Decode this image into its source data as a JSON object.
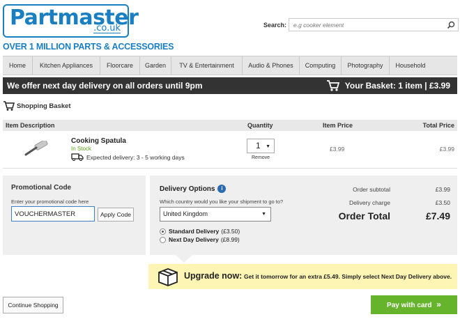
{
  "header": {
    "logo_main": "Partmaster",
    "logo_sub": ".co.uk",
    "tagline": "OVER 1 MILLION PARTS & ACCESSORIES",
    "search_label": "Search:",
    "search_placeholder": "e.g cooker element"
  },
  "nav": {
    "items": [
      {
        "label": "Home"
      },
      {
        "label": "Kitchen Appliances"
      },
      {
        "label": "Floorcare"
      },
      {
        "label": "Garden"
      },
      {
        "label": "TV & Entertainment"
      },
      {
        "label": "Audio & Phones"
      },
      {
        "label": "Computing"
      },
      {
        "label": "Photography"
      },
      {
        "label": "Household"
      }
    ]
  },
  "bar": {
    "message": "We offer next day delivery on all orders until 9pm",
    "basket": "Your Basket: 1 item | £3.99"
  },
  "basket": {
    "title": "Shopping Basket",
    "columns": {
      "description": "Item Description",
      "quantity": "Quantity",
      "item_price": "Item Price",
      "total_price": "Total Price"
    },
    "items": [
      {
        "name": "Cooking Spatula",
        "stock": "In Stock",
        "delivery": "Expected delivery: 3 - 5 working days",
        "quantity": "1",
        "remove": "Remove",
        "price": "£3.99",
        "total": "£3.99"
      }
    ]
  },
  "promo": {
    "title": "Promotional Code",
    "hint": "Enter your promotional code here",
    "value": "VOUCHERMASTER",
    "apply_label": "Apply Code"
  },
  "delivery": {
    "title": "Delivery Options",
    "question": "Which country would you like your shipment to go to?",
    "country": "United Kingdom",
    "options": [
      {
        "name": "Standard Delivery",
        "price": "(£3.50)",
        "selected": true
      },
      {
        "name": "Next Day Delivery",
        "price": "(£8.99)",
        "selected": false
      }
    ]
  },
  "summary": {
    "subtotal_label": "Order subtotal",
    "subtotal": "£3.99",
    "delivery_label": "Delivery charge",
    "delivery": "£3.50",
    "total_label": "Order Total",
    "total": "£7.49"
  },
  "upgrade": {
    "title": "Upgrade now:",
    "text": "Get it tomorrow for an extra £5.49. Simply select Next Day Delivery above."
  },
  "actions": {
    "continue_label": "Continue Shopping",
    "pay_label": "Pay with card",
    "pay_arrows": "»"
  },
  "colors": {
    "brand_blue": "#1a7fc1",
    "pay_green": "#66b42c",
    "banner_yellow": "#fdf5b4",
    "bar_dark": "#333333"
  }
}
